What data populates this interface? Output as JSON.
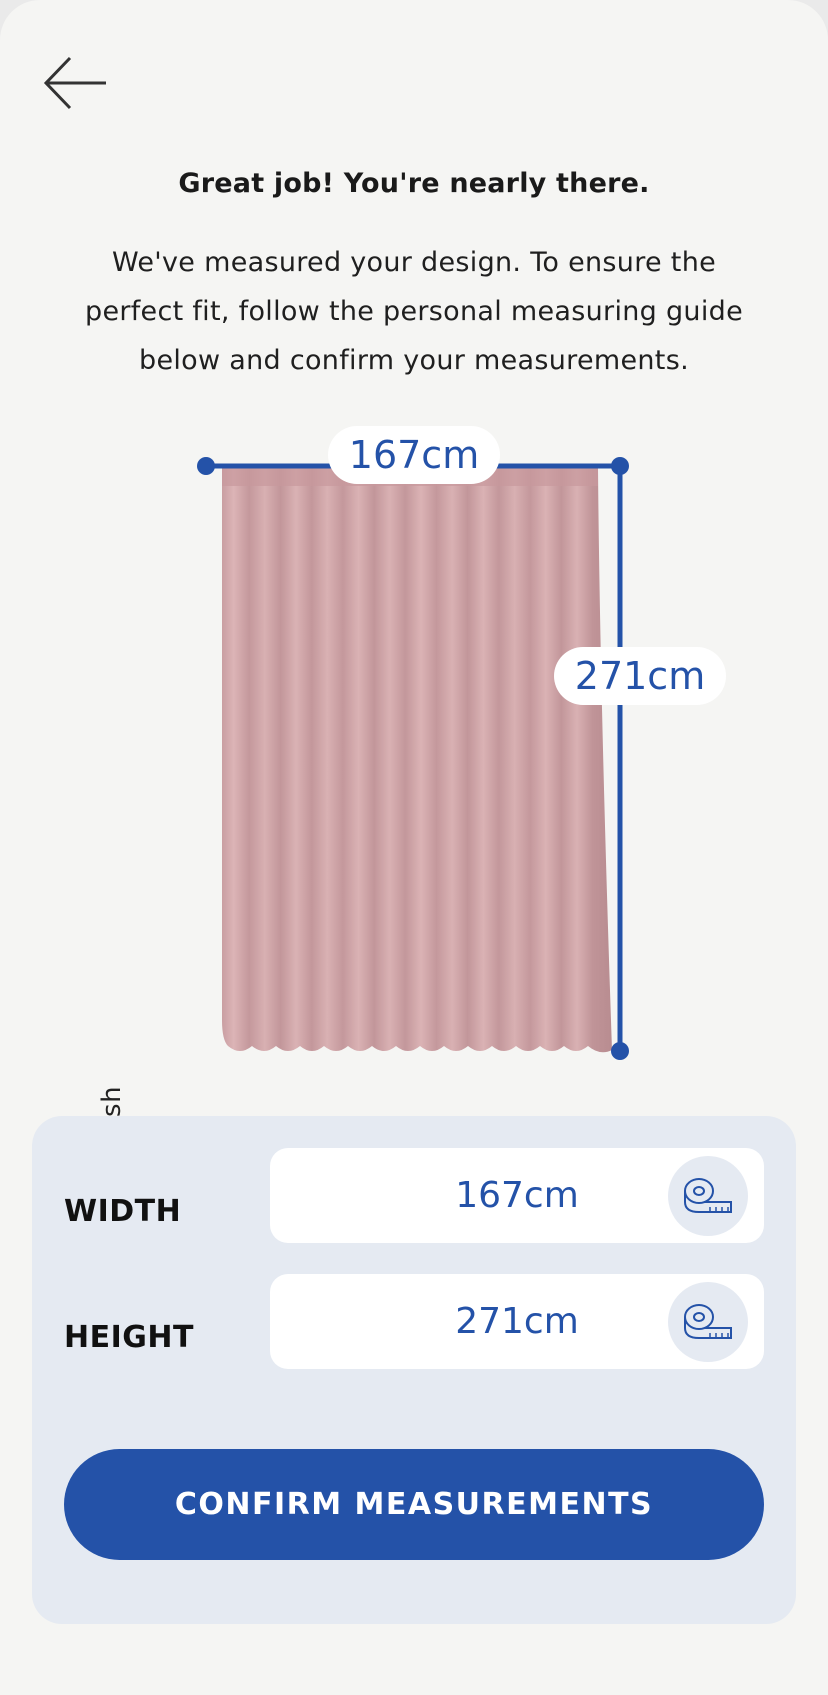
{
  "header": {
    "title": "Great job! You're nearly there.",
    "intro": "We've measured your design. To ensure the perfect fit, follow the personal measuring guide below and confirm your measurements.",
    "back_icon": "arrow-left-icon"
  },
  "preview": {
    "fabric_color_name": "Blush",
    "fabric_color": "#d3a8ab",
    "measure_line_color": "#2452a8",
    "width_label": "167cm",
    "height_label": "271cm"
  },
  "measurements": {
    "rows": [
      {
        "label": "WIDTH",
        "value": "167cm",
        "icon": "tape-measure-icon"
      },
      {
        "label": "HEIGHT",
        "value": "271cm",
        "icon": "tape-measure-icon"
      }
    ]
  },
  "actions": {
    "confirm_label": "CONFIRM MEASUREMENTS"
  },
  "theme": {
    "accent": "#2452a8",
    "panel_background": "#e5eaf2",
    "page_background": "#f5f5f3"
  }
}
